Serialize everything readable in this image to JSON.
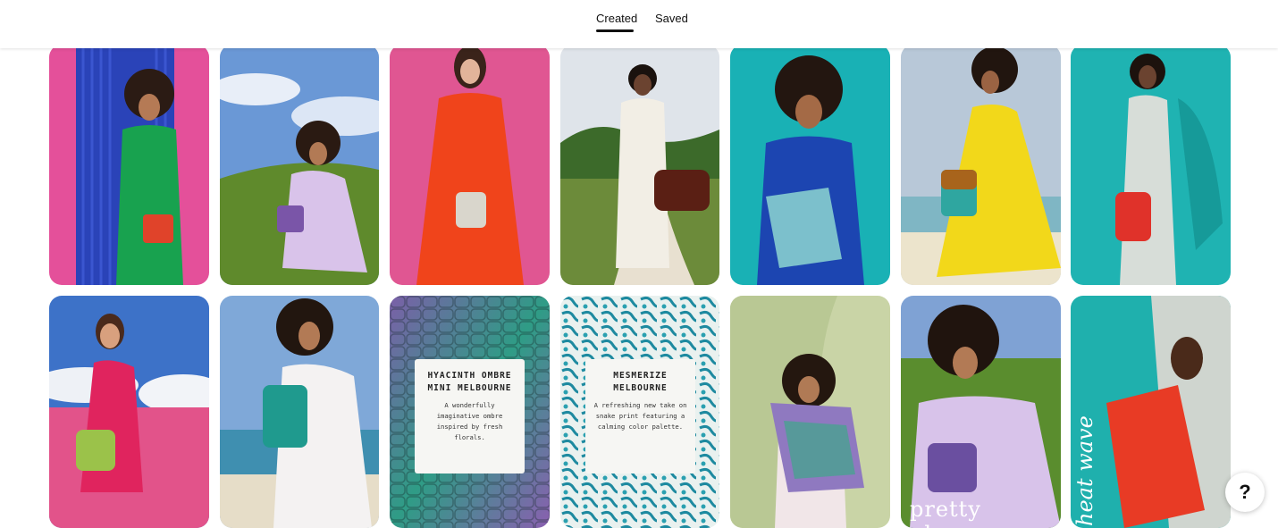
{
  "tabs": {
    "created": "Created",
    "saved": "Saved",
    "active": "created"
  },
  "pins": {
    "p9": {
      "title": "HYACINTH OMBRE MINI MELBOURNE",
      "body": "A wonderfully imaginative ombre inspired by fresh florals."
    },
    "p10": {
      "title": "MESMERIZE MELBOURNE",
      "body": "A refreshing new take on snake print featuring a calming color palette."
    },
    "p12": {
      "overlay": "pretty please"
    },
    "p13": {
      "overlay": "heat wave"
    }
  },
  "help": {
    "label": "?"
  },
  "colors": {
    "accent": "#111111",
    "background": "#ffffff"
  }
}
